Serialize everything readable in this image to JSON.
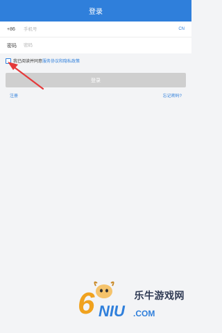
{
  "header": {
    "title": "登录"
  },
  "form": {
    "phone": {
      "prefix": "+86",
      "placeholder": "手机号",
      "region": "CN"
    },
    "password": {
      "label": "密码",
      "placeholder": "密码"
    }
  },
  "agreement": {
    "text": "我已阅读并同意",
    "service_link": "服务协议",
    "and": "和",
    "privacy_link": "隐私政策",
    "checked": false
  },
  "login_button": {
    "label": "登录",
    "enabled": false
  },
  "links": {
    "register": "注册",
    "forgot": "忘记密码?"
  },
  "watermark": {
    "logo_text": "6NIU.COM",
    "site_name": "乐牛游戏网"
  },
  "colors": {
    "accent": "#2f7fdb",
    "arrow": "#e5393a",
    "disabled_button": "#cfcfcf"
  }
}
